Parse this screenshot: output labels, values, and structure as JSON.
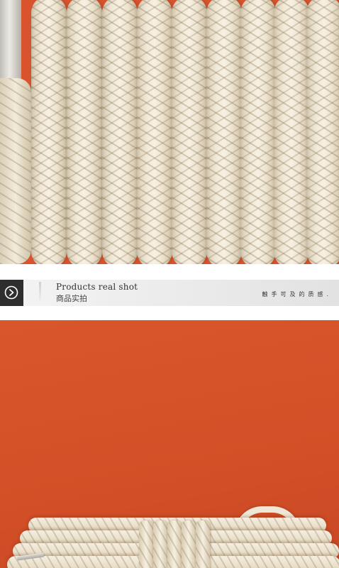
{
  "banner": {
    "title": "Products real shot",
    "subtitle": "商品实拍",
    "tagline": "触手可及的质感.",
    "icon": "play-arrow-circle-icon"
  },
  "colors": {
    "background_orange": "#d9542e",
    "rope_cream": "#f3ebda",
    "banner_grey": "#eaeaea",
    "icon_box_dark": "#2e2e2e"
  }
}
